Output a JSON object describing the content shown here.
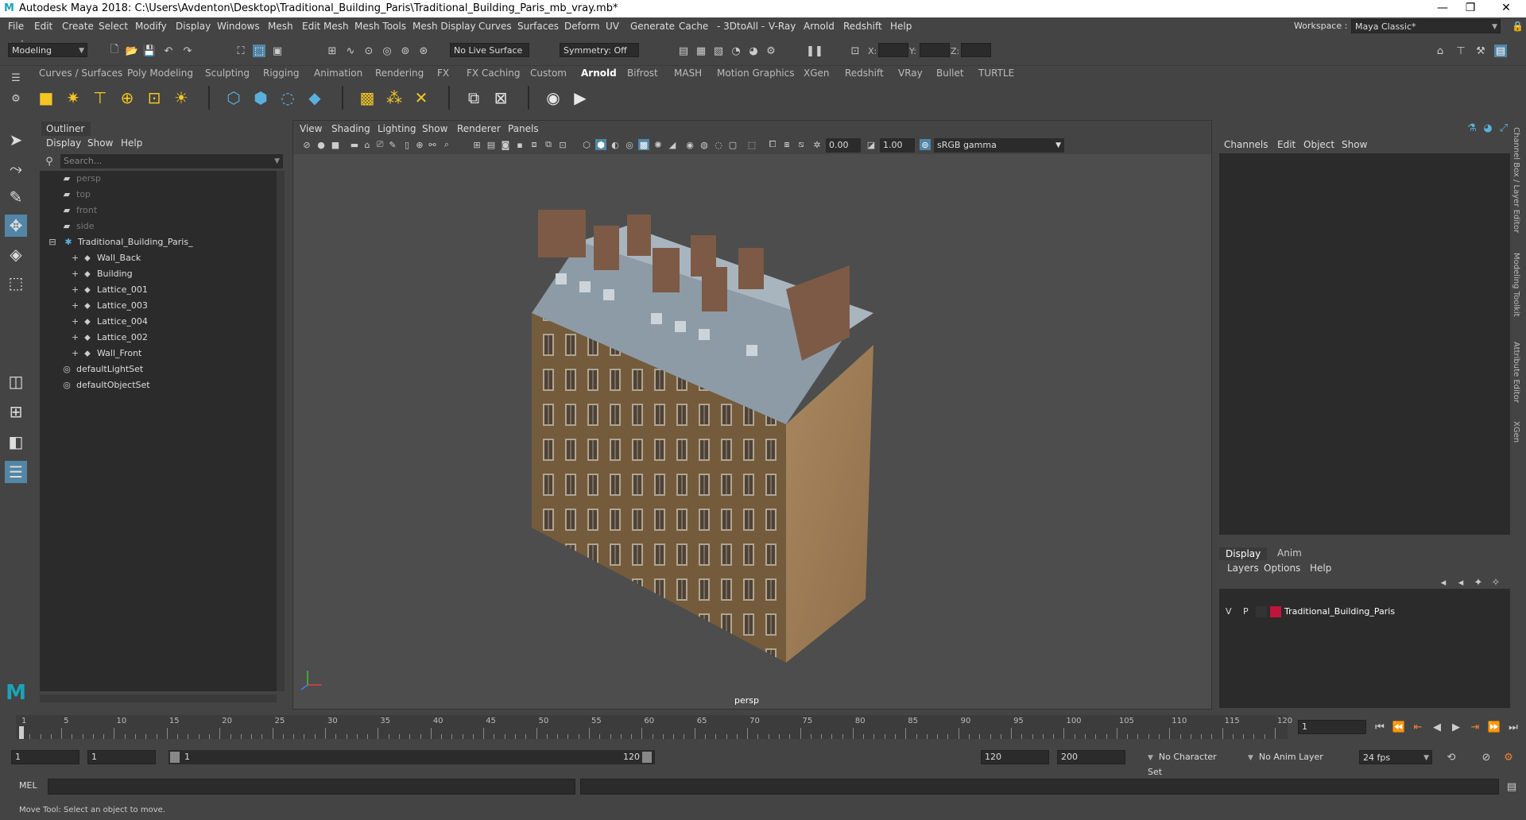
{
  "title_bar": {
    "title": "Autodesk Maya 2018: C:\\Users\\Avdenton\\Desktop\\Traditional_Building_Paris\\Traditional_Building_Paris_mb_vray.mb*"
  },
  "menubar": {
    "items": [
      "File",
      "Edit",
      "Create",
      "Select",
      "Modify",
      "Display",
      "Windows",
      "Mesh",
      "Edit Mesh",
      "Mesh Tools",
      "Mesh Display",
      "Curves",
      "Surfaces",
      "Deform",
      "UV",
      "Generate",
      "Cache",
      "- 3DtoAll -",
      "V-Ray",
      "Arnold",
      "Redshift",
      "Help"
    ],
    "workspace_label": "Workspace :",
    "workspace_value": "Maya Classic*"
  },
  "status_line": {
    "mode": "Modeling",
    "live_surface": "No Live Surface",
    "symmetry": "Symmetry: Off",
    "x_label": "X:",
    "y_label": "Y:",
    "z_label": "Z:"
  },
  "shelf": {
    "tabs": [
      "Curves / Surfaces",
      "Poly Modeling",
      "Sculpting",
      "Rigging",
      "Animation",
      "Rendering",
      "FX",
      "FX Caching",
      "Custom",
      "Arnold",
      "Bifrost",
      "MASH",
      "Motion Graphics",
      "XGen",
      "Redshift",
      "VRay",
      "Bullet",
      "TURTLE"
    ],
    "active_tab": "Arnold"
  },
  "outliner": {
    "title": "Outliner",
    "menu": [
      "Display",
      "Show",
      "Help"
    ],
    "search_placeholder": "Search...",
    "items": [
      {
        "label": "persp",
        "icon": "camera-icon",
        "dim": true,
        "indent": 1
      },
      {
        "label": "top",
        "icon": "camera-icon",
        "dim": true,
        "indent": 1
      },
      {
        "label": "front",
        "icon": "camera-icon",
        "dim": true,
        "indent": 1
      },
      {
        "label": "side",
        "icon": "camera-icon",
        "dim": true,
        "indent": 1
      },
      {
        "label": "Traditional_Building_Paris_",
        "icon": "transform-icon",
        "dim": false,
        "indent": 0
      },
      {
        "label": "Wall_Back",
        "icon": "mesh-icon",
        "dim": false,
        "indent": 2
      },
      {
        "label": "Building",
        "icon": "mesh-icon",
        "dim": false,
        "indent": 2
      },
      {
        "label": "Lattice_001",
        "icon": "mesh-icon",
        "dim": false,
        "indent": 2
      },
      {
        "label": "Lattice_003",
        "icon": "mesh-icon",
        "dim": false,
        "indent": 2
      },
      {
        "label": "Lattice_004",
        "icon": "mesh-icon",
        "dim": false,
        "indent": 2
      },
      {
        "label": "Lattice_002",
        "icon": "mesh-icon",
        "dim": false,
        "indent": 2
      },
      {
        "label": "Wall_Front",
        "icon": "mesh-icon",
        "dim": false,
        "indent": 2
      },
      {
        "label": "defaultLightSet",
        "icon": "set-icon",
        "dim": false,
        "indent": 1
      },
      {
        "label": "defaultObjectSet",
        "icon": "set-icon",
        "dim": false,
        "indent": 1
      }
    ]
  },
  "viewport": {
    "menu": [
      "View",
      "Shading",
      "Lighting",
      "Show",
      "Renderer",
      "Panels"
    ],
    "exposure": "0.00",
    "gamma": "1.00",
    "color_space": "sRGB gamma",
    "camera_label": "persp"
  },
  "channel_box": {
    "menu": [
      "Channels",
      "Edit",
      "Object",
      "Show"
    ],
    "layer_tabs": [
      "Display",
      "Anim"
    ],
    "layer_menu": [
      "Layers",
      "Options",
      "Help"
    ],
    "layer": {
      "v": "V",
      "p": "P",
      "name": "Traditional_Building_Paris",
      "color": "#c0143c"
    },
    "side_tabs": [
      "Channel Box / Layer Editor",
      "Modeling Toolkit",
      "Attribute Editor",
      "XGen"
    ]
  },
  "time_slider": {
    "ticks": [
      1,
      5,
      10,
      15,
      20,
      25,
      30,
      35,
      40,
      45,
      50,
      55,
      60,
      65,
      70,
      75,
      80,
      85,
      90,
      95,
      100,
      105,
      110,
      115,
      120
    ],
    "current_frame": "1"
  },
  "range_slider": {
    "start": "1",
    "playback_start": "1",
    "range_start_label": "1",
    "range_end_label": "120",
    "playback_end": "120",
    "end": "200",
    "character_set": "No Character Set",
    "anim_layer": "No Anim Layer",
    "fps": "24 fps"
  },
  "command_line": {
    "label": "MEL"
  },
  "help_line": {
    "text": "Move Tool: Select an object to move."
  }
}
